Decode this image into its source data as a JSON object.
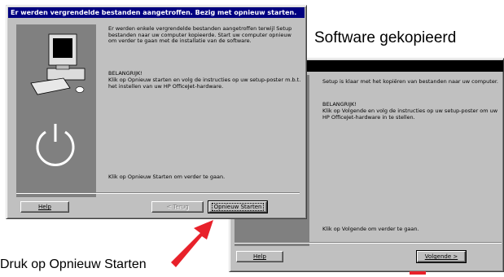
{
  "dialog1": {
    "title": "Er werden vergrendelde bestanden aangetroffen. Bezig met opnieuw starten.",
    "body_paragraph": "Er werden enkele vergrendelde bestanden aangetroffen terwijl Setup bestanden naar uw computer kopieerde. Start uw computer opnieuw om verder te gaan met de installatie van de software.",
    "important_heading": "BELANGRIJK!",
    "important_text": "Klik op Opnieuw starten en volg de instructies op uw setup-poster m.b.t. het instellen van uw HP OfficeJet-hardware.",
    "footer_text": "Klik op Opnieuw Starten om verder te gaan.",
    "buttons": {
      "help": "Help",
      "back": "< Terug",
      "restart": "Opnieuw Starten"
    }
  },
  "dialog2": {
    "body_paragraph": "Setup is klaar met het kopiëren van bestanden naar uw computer.",
    "important_heading": "BELANGRIJK!",
    "important_text": "Klik op Volgende en volg de instructies op uw setup-poster om uw HP OfficeJet-hardware in te stellen.",
    "footer_text": "Klik op Volgende om verder te gaan.",
    "buttons": {
      "help": "Help",
      "next": "Volgende >"
    }
  },
  "captions": {
    "software_copied": "Software gekopieerd",
    "press_restart": "Druk op Opnieuw Starten"
  },
  "icons": [
    "computer-icon",
    "power-icon",
    "arrow-icon"
  ],
  "colors": {
    "titlebar": "#000080",
    "dialog": "#c0c0c0",
    "side_panel": "#808080",
    "arrow": "#e8212a"
  }
}
